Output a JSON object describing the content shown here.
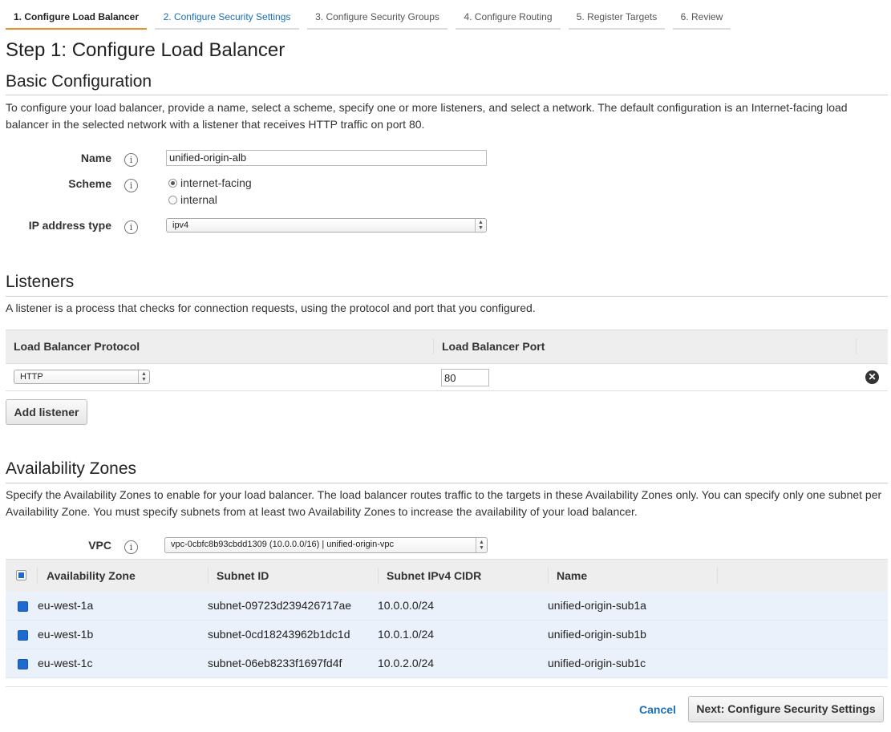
{
  "wizard": {
    "tabs": [
      {
        "label": "1. Configure Load Balancer"
      },
      {
        "label": "2. Configure Security Settings"
      },
      {
        "label": "3. Configure Security Groups"
      },
      {
        "label": "4. Configure Routing"
      },
      {
        "label": "5. Register Targets"
      },
      {
        "label": "6. Review"
      }
    ],
    "active_index": 0
  },
  "page": {
    "title": "Step 1: Configure Load Balancer"
  },
  "basic": {
    "heading": "Basic Configuration",
    "description": "To configure your load balancer, provide a name, select a scheme, specify one or more listeners, and select a network. The default configuration is an Internet-facing load balancer in the selected network with a listener that receives HTTP traffic on port 80.",
    "name_label": "Name",
    "name_value": "unified-origin-alb",
    "scheme_label": "Scheme",
    "scheme_options": [
      "internet-facing",
      "internal"
    ],
    "scheme_selected": "internet-facing",
    "ip_type_label": "IP address type",
    "ip_type_value": "ipv4",
    "info_glyph": "i"
  },
  "listeners": {
    "heading": "Listeners",
    "description": "A listener is a process that checks for connection requests, using the protocol and port that you configured.",
    "col_protocol": "Load Balancer Protocol",
    "col_port": "Load Balancer Port",
    "rows": [
      {
        "protocol": "HTTP",
        "port": "80"
      }
    ],
    "add_button": "Add listener",
    "remove_glyph": "✕"
  },
  "az": {
    "heading": "Availability Zones",
    "description": "Specify the Availability Zones to enable for your load balancer. The load balancer routes traffic to the targets in these Availability Zones only. You can specify only one subnet per Availability Zone. You must specify subnets from at least two Availability Zones to increase the availability of your load balancer.",
    "vpc_label": "VPC",
    "vpc_value": "vpc-0cbfc8b93cbdd1309 (10.0.0.0/16) | unified-origin-vpc",
    "columns": [
      "Availability Zone",
      "Subnet ID",
      "Subnet IPv4 CIDR",
      "Name"
    ],
    "rows": [
      {
        "zone": "eu-west-1a",
        "subnet": "subnet-09723d239426717ae",
        "cidr": "10.0.0.0/24",
        "name": "unified-origin-sub1a"
      },
      {
        "zone": "eu-west-1b",
        "subnet": "subnet-0cd18243962b1dc1d",
        "cidr": "10.0.1.0/24",
        "name": "unified-origin-sub1b"
      },
      {
        "zone": "eu-west-1c",
        "subnet": "subnet-06eb8233f1697fd4f",
        "cidr": "10.0.2.0/24",
        "name": "unified-origin-sub1c"
      }
    ]
  },
  "footer": {
    "cancel": "Cancel",
    "next": "Next: Configure Security Settings"
  },
  "colors": {
    "accent_tab": "#e8902e",
    "link": "#1a6fb5",
    "checkbox": "#1d6ad0",
    "selected_row": "#eaf1fb"
  },
  "icons": {
    "info": "info-icon",
    "remove": "close-circle-icon",
    "select_arrow": "up-down-arrows-icon"
  }
}
